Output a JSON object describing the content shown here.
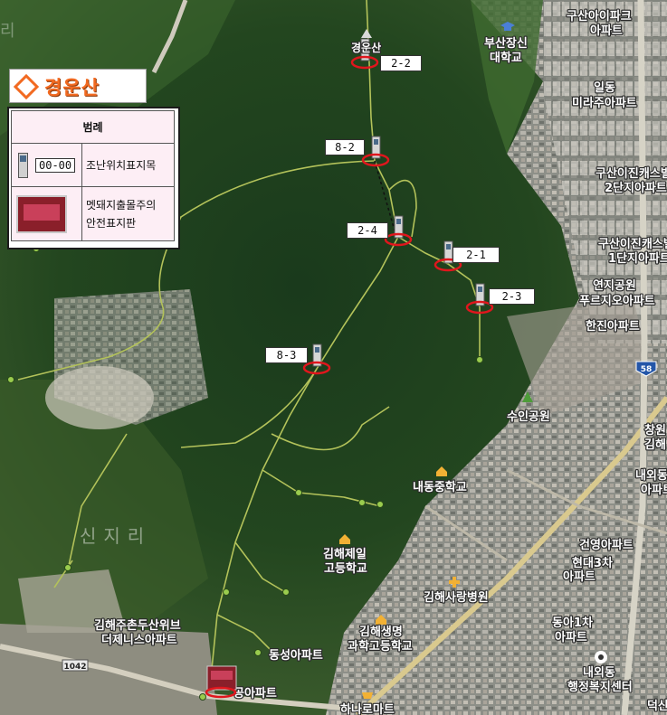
{
  "title": "경운산",
  "legend": {
    "header": "범례",
    "row1_code": "00-00",
    "row1_label": "조난위치표지목",
    "row2_label_line1": "멧돼지출몰주의",
    "row2_label_line2": "안전표지판"
  },
  "markers": [
    {
      "code": "2-2"
    },
    {
      "code": "8-2"
    },
    {
      "code": "2-4"
    },
    {
      "code": "2-1"
    },
    {
      "code": "2-3"
    },
    {
      "code": "8-3"
    }
  ],
  "places": {
    "peak": "경운산",
    "university_1": "부산장신",
    "university_2": "대학교",
    "gusan_ipark_1": "구산아이파크",
    "gusan_ipark_2": "아파트",
    "ildong_1": "일동",
    "ildong_2": "미라주아파트",
    "gusan2_1": "구산이진캐스빌",
    "gusan2_2": "2단지아파트",
    "gusan1_1": "구산이진캐스빌",
    "gusan1_2": "1단지아파트",
    "yeonji_1": "연지공원",
    "yeonji_2": "푸르지오아파트",
    "hanjin": "한진아파트",
    "suin_park": "수인공원",
    "changwon_1": "창원",
    "changwon_2": "김해",
    "naeoe_1": "내외동",
    "naeoe_2": "아파트",
    "naedong_mid": "내동중학교",
    "jeil_1": "김해제일",
    "jeil_2": "고등학교",
    "sinjiri": "신지리",
    "sarang": "김해사랑병원",
    "geonyeong": "건영아파트",
    "hyundai_1": "현대3차",
    "hyundai_2": "아파트",
    "donga_1": "동아1차",
    "donga_2": "아파트",
    "duksan_1": "김해주촌두산위브",
    "duksan_2": "더제니스아파트",
    "saengmyeong_1": "김해생명",
    "saengmyeong_2": "과학고등학교",
    "dongseong": "동성아파트",
    "gong": "공아파트",
    "welfare_1": "내외동",
    "welfare_2": "행정복지센터",
    "hanaro": "하나로마트",
    "deoksan": "덕산",
    "route_58": "58",
    "route_1042": "1042",
    "corner_text": "리"
  },
  "colors": {
    "forest_dark": "#16301a",
    "forest_mid": "#2e5226",
    "urban": "#9a9a92",
    "trail": "#b7c45a",
    "marker_ring": "#e0161d",
    "accent": "#f26a21"
  }
}
